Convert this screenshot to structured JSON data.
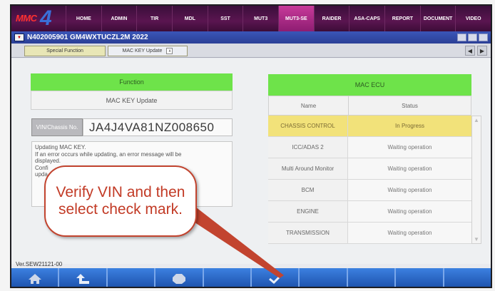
{
  "logo": {
    "brand": "MMC",
    "number": "4"
  },
  "nav": {
    "items": [
      "HOME",
      "ADMIN",
      "TIR",
      "MDL",
      "SST",
      "MUT3",
      "MUT3-SE",
      "RAIDER",
      "ASA-CAPS",
      "REPORT",
      "DOCUMENT",
      "VIDEO"
    ],
    "active": "MUT3-SE"
  },
  "titlebar": {
    "text": "N402005901   GM4WXTUCZL2M 2022"
  },
  "tabs": [
    {
      "label": "Special Function"
    },
    {
      "label": "MAC KEY Update",
      "close": "x"
    }
  ],
  "function_panel": {
    "header": "Function",
    "name": "MAC KEY Update",
    "vin_label": "VIN/Chassis No.",
    "vin_value": "JA4J4VA81NZ008650",
    "message_lines": [
      "Updating MAC KEY.",
      "If an error occurs while updating, an error message will be",
      "displayed.",
      "Confi                                              to continue",
      "upda"
    ]
  },
  "ecu_panel": {
    "header": "MAC ECU",
    "columns": [
      "Name",
      "Status"
    ],
    "rows": [
      {
        "name": "CHASSIS CONTROL",
        "status": "In Progress",
        "highlight": true
      },
      {
        "name": "ICC/ADAS 2",
        "status": "Waiting operation"
      },
      {
        "name": "Multi Around Monitor",
        "status": "Waiting operation"
      },
      {
        "name": "BCM",
        "status": "Waiting operation"
      },
      {
        "name": "ENGINE",
        "status": "Waiting operation"
      },
      {
        "name": "TRANSMISSION",
        "status": "Waiting operation"
      }
    ]
  },
  "version": "Ver.SEW21121-00",
  "toolbar": {
    "buttons": [
      "home-icon",
      "up-arrow-icon",
      "blank",
      "stop-icon",
      "blank",
      "check-icon",
      "blank",
      "blank",
      "blank",
      "blank"
    ]
  },
  "callout": {
    "text": "Verify VIN and then select check mark."
  },
  "colors": {
    "accent_green": "#6ee34a",
    "nav_purple": "#5a1550",
    "toolbar_blue": "#2f6fd0",
    "callout_red": "#c2442f",
    "highlight_yellow": "#f2e27a"
  }
}
